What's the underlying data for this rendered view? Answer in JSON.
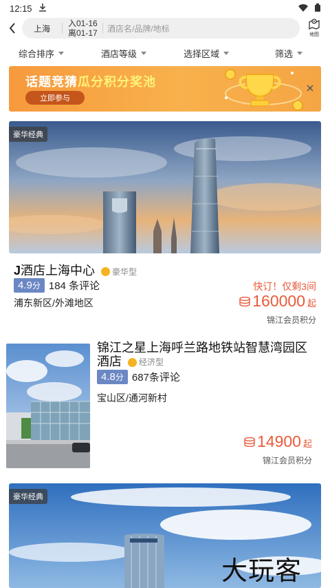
{
  "status_bar": {
    "time": "12:15"
  },
  "search": {
    "city": "上海",
    "checkin": "入01-16",
    "checkout": "离01-17",
    "placeholder": "酒店名/品牌/地标",
    "map_label": "地图"
  },
  "filters": [
    "综合排序",
    "酒店等级",
    "选择区域",
    "筛选"
  ],
  "banner": {
    "title_part1": "话题竞猜",
    "title_part2": "瓜分积分奖池",
    "button": "立即参与"
  },
  "hotels": [
    {
      "tag": "豪华经典",
      "name_prefix": "J",
      "name_rest": "酒店上海中心",
      "grade": "豪华型",
      "score": "4.9",
      "score_unit": "分",
      "reviews": "184 条评论",
      "area": "浦东新区/外滩地区",
      "urgent": "快订！仅剩3间",
      "price": "160000",
      "price_unit": "起",
      "price_note": "锦江会员积分"
    },
    {
      "name": "锦江之星上海呼兰路地铁站智慧湾园区酒店",
      "grade": "经济型",
      "score": "4.8",
      "score_unit": "分",
      "reviews": "687条评论",
      "area": "宝山区/通河新村",
      "price": "14900",
      "price_unit": "起",
      "price_note": "锦江会员积分"
    },
    {
      "tag": "豪华经典"
    }
  ],
  "watermark": "大玩客",
  "colors": {
    "accent_red": "#e85a3a",
    "score_blue": "#6b87c4",
    "banner_orange": "#f79a3d",
    "grade_gold": "#f5b321"
  }
}
